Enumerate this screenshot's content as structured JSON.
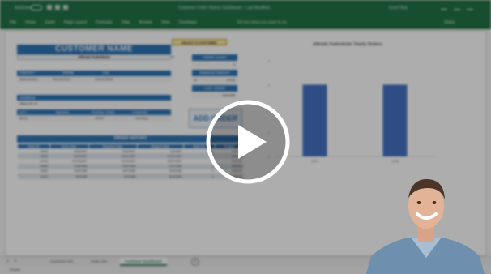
{
  "titlebar": {
    "autosave_label": "AutoSave",
    "document_title": "Customer Order History Dashboard - Last Modified",
    "account_label": "Excel Mvp"
  },
  "ribbon": {
    "tabs": [
      "File",
      "Home",
      "Insert",
      "Page Layout",
      "Formulas",
      "Data",
      "Review",
      "View",
      "Developer"
    ],
    "tell_me_placeholder": "Tell me what you want to do",
    "share_label": "Share"
  },
  "dashboard": {
    "customer_name_header": "CUSTOMER NAME",
    "customer_name_value": "Alfreds Futterkiste",
    "select_button_label": "SELECT A CUSTOMER",
    "contact": {
      "headers": [
        "CONTACT",
        "PHONE",
        "FAX"
      ],
      "values": [
        "Maria Anders",
        "030-0074321",
        "030-0076545"
      ]
    },
    "address_header": "ADDRESS",
    "address_value": "Obere Str. 57",
    "location": {
      "headers": [
        "CITY",
        "REGION",
        "POSTAL CODE",
        "COUNTRY"
      ],
      "values": [
        "Berlin",
        "",
        "12209",
        "Germany"
      ]
    },
    "stats": {
      "order_count_label": "ORDER COUNT",
      "order_count_value": "6",
      "average_freight_label": "AVERAGE FREIGHT",
      "average_freight_currency": "$",
      "average_freight_value": "37.60",
      "last_order_label": "LAST ORDER",
      "last_order_value": "4/9/1998"
    },
    "add_order_label": "ADD ORDER",
    "order_history": {
      "title": "ORDER HISTORY",
      "columns": [
        "Order ID",
        "Order Date",
        "Required Date",
        "Shipped Date",
        "Ship Via",
        "Freight"
      ],
      "rows": [
        [
          "10643",
          "8/25/1997",
          "9/22/1997",
          "9/2/1997",
          "1",
          "$ 29.46"
        ],
        [
          "10692",
          "10/3/1997",
          "10/31/1997",
          "10/13/1997",
          "2",
          "$ 61.02"
        ],
        [
          "10702",
          "10/13/1997",
          "11/24/1997",
          "10/21/1997",
          "1",
          "$ 23.94"
        ],
        [
          "10835",
          "1/15/1998",
          "2/12/1998",
          "1/21/1998",
          "3",
          "$ 69.53"
        ],
        [
          "10952",
          "3/16/1998",
          "4/27/1998",
          "3/24/1998",
          "1",
          "$ 40.42"
        ],
        [
          "11011",
          "4/9/1998",
          "5/7/1998",
          "4/13/1998",
          "1",
          "$ 1.21"
        ]
      ]
    }
  },
  "chart_data": {
    "type": "bar",
    "title": "Alfreds Futterkiste Yearly Orders",
    "categories": [
      "1997",
      "1998"
    ],
    "values": [
      3,
      3
    ],
    "ylim": [
      0,
      4
    ],
    "yticks": [
      "0",
      "1",
      "2",
      "3",
      "4"
    ],
    "xlabel": "",
    "ylabel": "",
    "grid": false,
    "bar_color": "#4472c4"
  },
  "sheet_tabs": [
    "Customer Info",
    "Order Info",
    "Customer Dashboard"
  ],
  "active_sheet": "Customer Dashboard",
  "statusbar": {
    "ready": "Ready",
    "zoom": "100%"
  },
  "video_overlay": {
    "play_icon": "play-icon",
    "presenter": "presenter-webcam"
  },
  "colors": {
    "excel_green": "#217346",
    "header_blue": "#2e75b6",
    "bar_blue": "#4472c4",
    "select_button": "#fbe9a6"
  }
}
